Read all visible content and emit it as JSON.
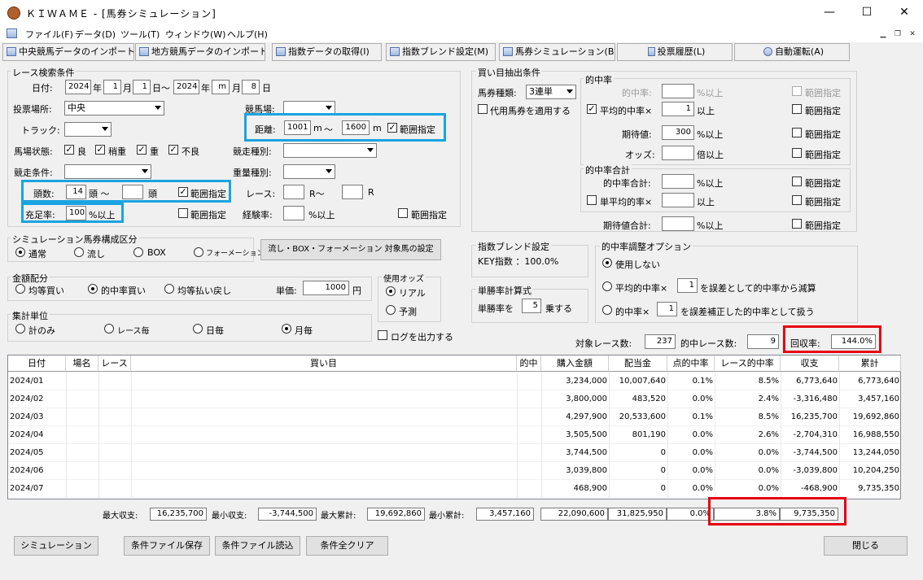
{
  "window": {
    "title": "ＫＩＷＡＭＥ - [馬券シミュレーション]",
    "minimize": "—",
    "maximize": "☐",
    "close": "✕"
  },
  "menu": [
    "ファイル(F)",
    "データ(D)",
    "ツール(T)",
    "ウィンドウ(W)",
    "ヘルプ(H)"
  ],
  "toolbar": [
    "中央競馬データのインポート(J)",
    "地方競馬データのインポート(N)",
    "指数データの取得(I)",
    "指数ブレンド設定(M)",
    "馬券シミュレーション(B)",
    "投票履歴(L)",
    "自動運転(A)"
  ],
  "search": {
    "group": "レース検索条件",
    "date_label": "日付:",
    "y1": "2024",
    "m1": "1",
    "d1": "1",
    "y2": "2024",
    "m2": "m",
    "d2": "8",
    "u_year": "年",
    "u_month": "月",
    "u_day": "日",
    "u_range": "日～",
    "u_year2": "年",
    "u_month2": "月",
    "u_day2": "日",
    "venue_label": "投票場所:",
    "venue": "中央",
    "course_label": "競馬場:",
    "course": "",
    "track_label": "トラック:",
    "track": "",
    "distance_label": "距離:",
    "dist_from": "1001",
    "dist_to": "1600",
    "m": "m",
    "tilde": "～",
    "range_label": "範囲指定",
    "cond_label": "馬場状態:",
    "cond_good": "良",
    "cond_slight": "稍重",
    "cond_heavy": "重",
    "cond_bad": "不良",
    "race_type_label": "競走種別:",
    "race_cond_label": "競走条件:",
    "weight_type_label": "重量種別:",
    "heads_label": "頭数:",
    "heads_from": "14",
    "heads_unit": "頭 ～",
    "heads_to": "",
    "heads_unit2": "頭",
    "heads_range": "範囲指定",
    "race_label": "レース:",
    "race_from": "",
    "race_mid": "R～",
    "race_to": "",
    "race_end": "R",
    "fill_label": "充足率:",
    "fill_val": "100",
    "fill_unit": "%以上",
    "fill_range": "範囲指定",
    "exp_label": "経験率:",
    "exp_val": "",
    "exp_unit": "%以上",
    "exp_range": "範囲指定"
  },
  "betsel": {
    "group": "買い目抽出条件",
    "type_label": "馬券種類:",
    "type": "3連単",
    "proxy": "代用馬券を適用する",
    "hit_group": "的中率",
    "hitrate_label": "的中率:",
    "hitrate": "",
    "hitrate_unit": "%以上",
    "r1": "範囲指定",
    "avghit_label": "平均的中率×",
    "avghit": "1",
    "avghit_unit": "以上",
    "r2": "範囲指定",
    "exp_label": "期待値:",
    "exp": "300",
    "exp_unit": "%以上",
    "r3": "範囲指定",
    "odds_label": "オッズ:",
    "odds": "",
    "odds_unit": "倍以上",
    "r4": "範囲指定",
    "total_group": "的中率合計",
    "total_label": "的中率合計:",
    "total": "",
    "total_unit": "%以上",
    "r5": "範囲指定",
    "single_label": "単平均的率×",
    "single": "",
    "single_unit": "以上",
    "r6": "範囲指定",
    "exptot_label": "期待値合計:",
    "exptot": "",
    "exptot_unit": "%以上",
    "r7": "範囲指定"
  },
  "sim": {
    "group": "シミュレーション馬券構成区分",
    "opt1": "通常",
    "opt2": "流し",
    "opt3": "BOX",
    "opt4": "フォーメーション",
    "target_btn": "流し・BOX・フォーメーション 対象馬の設定"
  },
  "alloc": {
    "group": "金額配分",
    "opt1": "均等買い",
    "opt2": "的中率買い",
    "opt3": "均等払い戻し",
    "unit_label": "単価:",
    "unit_val": "1000",
    "yen": "円"
  },
  "odds": {
    "group": "使用オッズ",
    "opt1": "リアル",
    "opt2": "予測"
  },
  "agg": {
    "group": "集計単位",
    "opt1": "計のみ",
    "opt2": "レース毎",
    "opt3": "日毎",
    "opt4": "月毎"
  },
  "log": "ログを出力する",
  "blend": {
    "group": "指数ブレンド設定",
    "text": "KEY指数 ：100.0%"
  },
  "single": {
    "group": "単勝率計算式",
    "label": "単勝率を",
    "val": "5",
    "unit": "乗する"
  },
  "adjust": {
    "group": "的中率調整オプション",
    "opt1": "使用しない",
    "opt2a": "平均的中率×",
    "opt2v": "1",
    "opt2b": "を誤差として的中率から減算",
    "opt3a": "的中率×",
    "opt3v": "1",
    "opt3b": "を誤差補正した的中率として扱う"
  },
  "stats": {
    "target_label": "対象レース数:",
    "target": "237",
    "hit_label": "的中レース数:",
    "hit": "9",
    "ret_label": "回収率:",
    "ret": "144.0%"
  },
  "table": {
    "headers": [
      "日付",
      "場名",
      "レース",
      "買い目",
      "的中",
      "購入金額",
      "配当金",
      "点的中率",
      "レース的中率",
      "収支",
      "累計"
    ],
    "rows": [
      [
        "2024/01",
        "",
        "",
        "",
        "",
        "3,234,000",
        "10,007,640",
        "0.1%",
        "8.5%",
        "6,773,640",
        "6,773,640"
      ],
      [
        "2024/02",
        "",
        "",
        "",
        "",
        "3,800,000",
        "483,520",
        "0.0%",
        "2.4%",
        "-3,316,480",
        "3,457,160"
      ],
      [
        "2024/03",
        "",
        "",
        "",
        "",
        "4,297,900",
        "20,533,600",
        "0.1%",
        "8.5%",
        "16,235,700",
        "19,692,860"
      ],
      [
        "2024/04",
        "",
        "",
        "",
        "",
        "3,505,500",
        "801,190",
        "0.0%",
        "2.6%",
        "-2,704,310",
        "16,988,550"
      ],
      [
        "2024/05",
        "",
        "",
        "",
        "",
        "3,744,500",
        "0",
        "0.0%",
        "0.0%",
        "-3,744,500",
        "13,244,050"
      ],
      [
        "2024/06",
        "",
        "",
        "",
        "",
        "3,039,800",
        "0",
        "0.0%",
        "0.0%",
        "-3,039,800",
        "10,204,250"
      ],
      [
        "2024/07",
        "",
        "",
        "",
        "",
        "468,900",
        "0",
        "0.0%",
        "0.0%",
        "-468,900",
        "9,735,350"
      ]
    ]
  },
  "summary": {
    "max_label": "最大収支:",
    "max": "16,235,700",
    "min_label": "最小収支:",
    "min": "-3,744,500",
    "maxcum_label": "最大累計:",
    "maxcum": "19,692,860",
    "mincum_label": "最小累計:",
    "mincum": "3,457,160",
    "buy": "22,090,600",
    "pay": "31,825,950",
    "pt": "0.0%",
    "race": "3.8%",
    "cum": "9,735,350"
  },
  "buttons": {
    "simulate": "シミュレーション",
    "save": "条件ファイル保存",
    "load": "条件ファイル読込",
    "clear": "条件全クリア",
    "close": "閉じる"
  },
  "colors": {
    "highlight_blue": "#1aa3e0",
    "highlight_red": "#e60012"
  }
}
